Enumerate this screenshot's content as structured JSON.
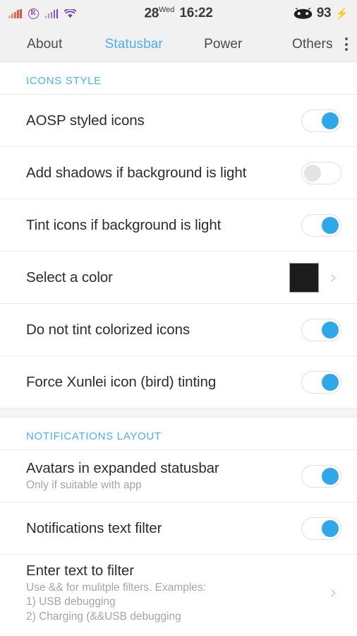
{
  "statusbar": {
    "left_icons": [
      {
        "name": "signal-bars-sim1",
        "color": "#e0523f"
      },
      {
        "name": "roaming-indicator",
        "label": "R",
        "color": "#7b3fb5"
      },
      {
        "name": "signal-bars-sim2",
        "color": "#7b3fb5"
      },
      {
        "name": "wifi-icon",
        "color": "#7b3fb5"
      }
    ],
    "date_day": "28",
    "date_weekday": "Wed",
    "time": "16:22",
    "battery_icon": "android-head-icon",
    "battery_level": "93",
    "charging_icon": "⚡"
  },
  "tabs": [
    {
      "label": "About",
      "active": false
    },
    {
      "label": "Statusbar",
      "active": true
    },
    {
      "label": "Power",
      "active": false
    },
    {
      "label": "Others",
      "active": false
    }
  ],
  "overflow_menu": "more-options-icon",
  "sections": [
    {
      "header": "ICONS STYLE",
      "rows": [
        {
          "title": "AOSP styled icons",
          "sub": "",
          "control": "toggle",
          "state": "on"
        },
        {
          "title": "Add shadows if background is light",
          "sub": "",
          "control": "toggle",
          "state": "off"
        },
        {
          "title": "Tint icons if background is light",
          "sub": "",
          "control": "toggle",
          "state": "on"
        },
        {
          "title": "Select a color",
          "sub": "",
          "control": "swatch",
          "swatch_color": "#1c1c1c",
          "chevron": "›"
        },
        {
          "title": "Do not tint colorized icons",
          "sub": "",
          "control": "toggle",
          "state": "on"
        },
        {
          "title": "Force Xunlei icon (bird) tinting",
          "sub": "",
          "control": "toggle",
          "state": "on"
        }
      ]
    },
    {
      "header": "NOTIFICATIONS LAYOUT",
      "rows": [
        {
          "title": "Avatars in expanded statusbar",
          "sub": "Only if suitable with app",
          "control": "toggle",
          "state": "on"
        },
        {
          "title": "Notifications text filter",
          "sub": "",
          "control": "toggle",
          "state": "on"
        },
        {
          "title": "Enter text to filter",
          "sub": "Use && for mulitple filters. Examples:\n1) USB debugging\n2) Charging (&&USB debugging",
          "control": "chevron",
          "chevron": "›"
        }
      ]
    }
  ],
  "colors": {
    "accent": "#4ab0ea",
    "toggle_on": "#30a8e8",
    "toggle_off": "#e4e4e4",
    "header_bg": "#f1f1f1"
  }
}
